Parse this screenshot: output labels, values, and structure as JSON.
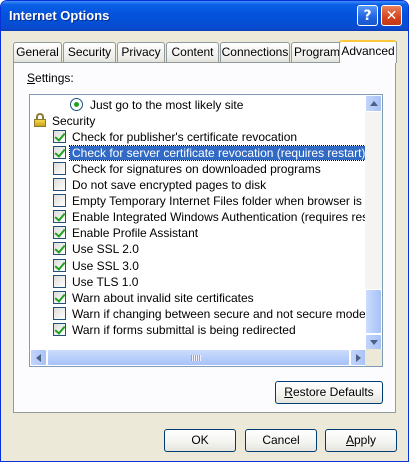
{
  "window": {
    "title": "Internet Options",
    "help_glyph": "?",
    "close_glyph": "✕"
  },
  "tabs": [
    {
      "label": "General",
      "active": false
    },
    {
      "label": "Security",
      "active": false
    },
    {
      "label": "Privacy",
      "active": false
    },
    {
      "label": "Content",
      "active": false
    },
    {
      "label": "Connections",
      "active": false
    },
    {
      "label": "Programs",
      "active": false
    },
    {
      "label": "Advanced",
      "active": true
    }
  ],
  "settings": {
    "label_first": "S",
    "label_rest": "ettings:",
    "items": [
      {
        "type": "radio",
        "label": "Just go to the most likely site",
        "checked": true
      },
      {
        "type": "group",
        "label": "Security",
        "icon": "lock-icon"
      },
      {
        "type": "checkbox",
        "label": "Check for publisher's certificate revocation",
        "checked": true
      },
      {
        "type": "checkbox",
        "label": "Check for server certificate revocation (requires restart)",
        "checked": true,
        "selected": true
      },
      {
        "type": "checkbox",
        "label": "Check for signatures on downloaded programs",
        "checked": false
      },
      {
        "type": "checkbox",
        "label": "Do not save encrypted pages to disk",
        "checked": false
      },
      {
        "type": "checkbox",
        "label": "Empty Temporary Internet Files folder when browser is closed",
        "checked": false
      },
      {
        "type": "checkbox",
        "label": "Enable Integrated Windows Authentication (requires restart)",
        "checked": true
      },
      {
        "type": "checkbox",
        "label": "Enable Profile Assistant",
        "checked": true
      },
      {
        "type": "checkbox",
        "label": "Use SSL 2.0",
        "checked": true
      },
      {
        "type": "checkbox",
        "label": "Use SSL 3.0",
        "checked": true
      },
      {
        "type": "checkbox",
        "label": "Use TLS 1.0",
        "checked": false
      },
      {
        "type": "checkbox",
        "label": "Warn about invalid site certificates",
        "checked": true
      },
      {
        "type": "checkbox",
        "label": "Warn if changing between secure and not secure mode",
        "checked": false
      },
      {
        "type": "checkbox",
        "label": "Warn if forms submittal is being redirected",
        "checked": true
      }
    ]
  },
  "buttons": {
    "restore_first": "R",
    "restore_rest": "estore Defaults",
    "ok": "OK",
    "cancel": "Cancel",
    "apply_first": "A",
    "apply_rest": "pply"
  },
  "colors": {
    "titlebar": "#0453dd",
    "selection": "#316ac5",
    "check": "#21a121",
    "active_tab_accent": "#ffc83c"
  }
}
